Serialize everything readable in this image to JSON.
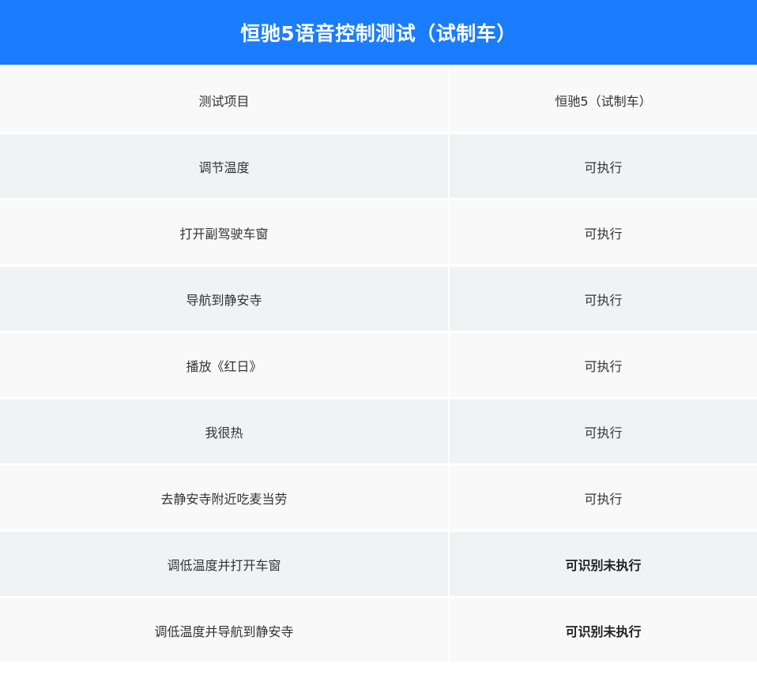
{
  "title": "恒驰5语音控制测试（试制车）",
  "rows": [
    {
      "item": "测试项目",
      "result": "恒驰5（试制车）"
    },
    {
      "item": "调节温度",
      "result": "可执行"
    },
    {
      "item": "打开副驾驶车窗",
      "result": "可执行"
    },
    {
      "item": "导航到静安寺",
      "result": "可执行"
    },
    {
      "item": "播放《红日》",
      "result": "可执行"
    },
    {
      "item": "我很热",
      "result": "可执行"
    },
    {
      "item": "去静安寺附近吃麦当劳",
      "result": "可执行"
    },
    {
      "item": "调低温度并打开车窗",
      "result": "可识别未执行"
    },
    {
      "item": "调低温度并导航到静安寺",
      "result": "可识别未执行"
    }
  ],
  "colors": {
    "header_bg": "#1a7cfe",
    "row_light": "#f9f9f9",
    "row_dark": "#f1f2f4"
  }
}
